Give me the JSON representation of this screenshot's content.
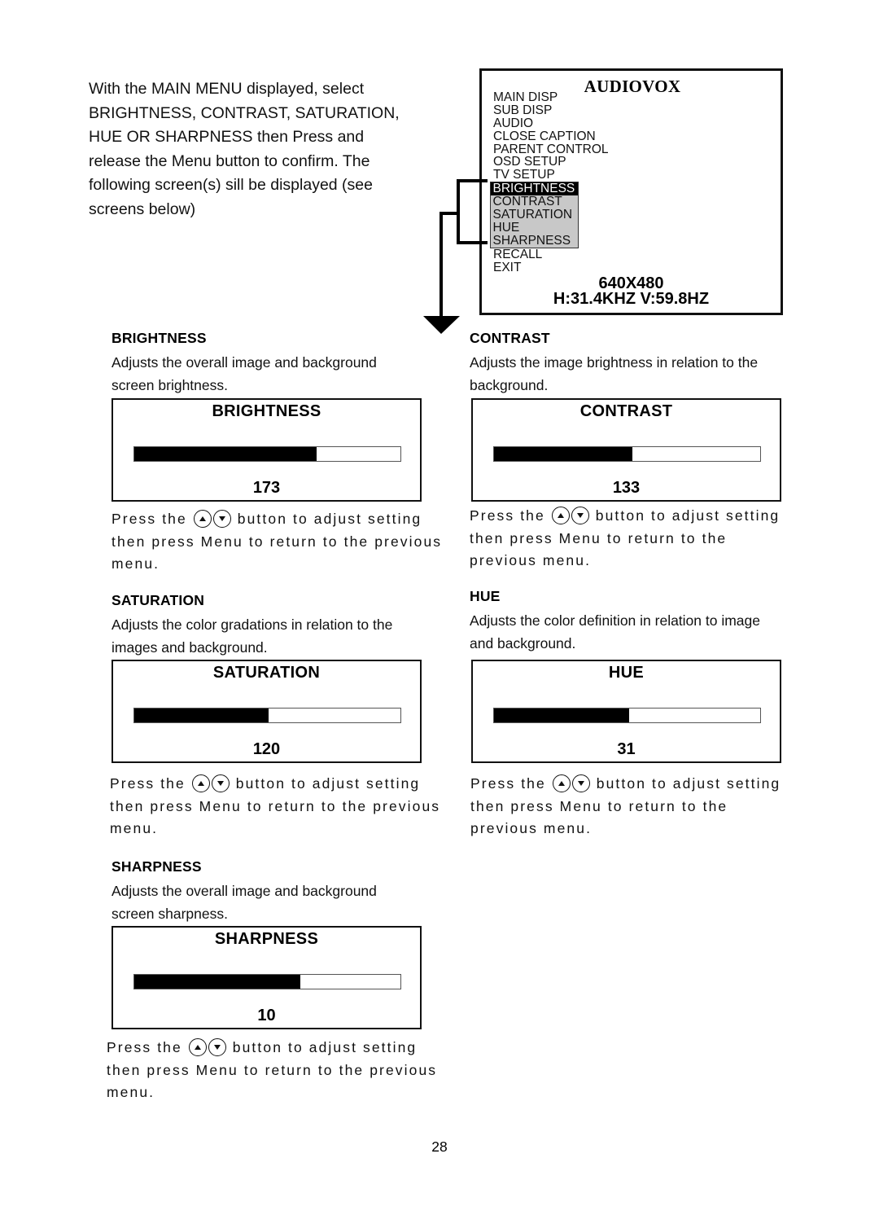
{
  "intro": {
    "lines": [
      "With the MAIN MENU displayed, select",
      "BRIGHTNESS, CONTRAST, SATURATION,",
      "HUE OR SHARPNESS then Press and",
      "release the Menu button to confirm. The",
      "following screen(s) sill be displayed (see",
      "screens below)"
    ]
  },
  "osd": {
    "brand": "AUDIOVOX",
    "menu_top": [
      "MAIN DISP",
      "SUB DISP",
      "AUDIO",
      "CLOSE CAPTION",
      "PARENT CONTROL",
      "OSD SETUP",
      "TV SETUP"
    ],
    "menu_group": [
      "BRIGHTNESS",
      "CONTRAST",
      "SATURATION",
      "HUE",
      "SHARPNESS"
    ],
    "selected_item": "BRIGHTNESS",
    "menu_bottom": [
      "RECALL",
      "EXIT"
    ],
    "resolution": "640X480",
    "frequency": "H:31.4KHZ V:59.8HZ",
    "group_highlight_color": "#c8c8c8"
  },
  "sections": [
    {
      "heading": "BRIGHTNESS",
      "desc_lines": [
        "Adjusts the overall image and background",
        "screen brightness."
      ],
      "panel_title": "BRIGHTNESS",
      "value": "173",
      "fill_fraction": 0.684,
      "instr_before": "Press the",
      "instr_after": "button to adjust setting",
      "instr_lines": [
        "then press Menu to return to the previous",
        "menu."
      ]
    },
    {
      "heading": "CONTRAST",
      "desc_lines": [
        "Adjusts the image brightness in relation to the",
        "background."
      ],
      "panel_title": "CONTRAST",
      "value": "133",
      "fill_fraction": 0.52,
      "instr_before": "Press the",
      "instr_after": "button to adjust setting",
      "instr_lines": [
        "then press Menu to return to the",
        "previous menu."
      ]
    },
    {
      "heading": "SATURATION",
      "desc_lines": [
        "Adjusts the color gradations in relation to the",
        "images and background."
      ],
      "panel_title": "SATURATION",
      "value": "120",
      "fill_fraction": 0.505,
      "instr_before": "Press the",
      "instr_after": "button to adjust setting",
      "instr_lines": [
        "then press Menu to return to the previous",
        "menu."
      ]
    },
    {
      "heading": "HUE",
      "desc_lines": [
        "Adjusts the color definition in relation to image",
        "and background."
      ],
      "panel_title": "HUE",
      "value": "31",
      "fill_fraction": 0.507,
      "instr_before": "Press the",
      "instr_after": "button to adjust setting",
      "instr_lines": [
        "then press Menu to return to the",
        "previous menu."
      ]
    },
    {
      "heading": "SHARPNESS",
      "desc_lines": [
        "Adjusts the overall image and background",
        "screen sharpness."
      ],
      "panel_title": "SHARPNESS",
      "value": "10",
      "fill_fraction": 0.623,
      "instr_before": "Press the",
      "instr_after": "button to adjust setting",
      "instr_lines": [
        "then press Menu to return to the previous",
        "menu."
      ]
    }
  ],
  "icons": {
    "up": "up-arrow-button-icon",
    "down": "down-arrow-button-icon"
  },
  "page_number": "28"
}
